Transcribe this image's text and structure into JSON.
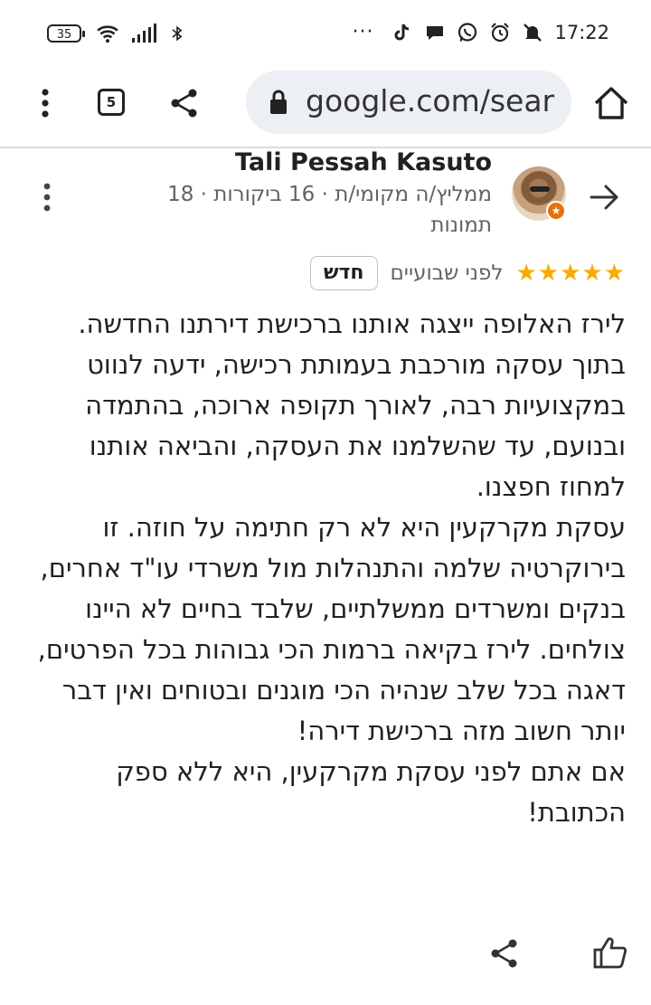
{
  "status_bar": {
    "battery": "35",
    "time": "17:22",
    "overflow": "···",
    "icons": [
      "wifi-icon",
      "signal-icon",
      "bluetooth-icon",
      "tiktok-icon",
      "chat-icon",
      "whatsapp-icon",
      "alarm-icon",
      "mute-icon"
    ]
  },
  "browser": {
    "tab_count": "5",
    "url": "google.com/sear",
    "icons": [
      "menu-dots-icon",
      "share-icon",
      "lock-icon",
      "home-icon"
    ]
  },
  "review": {
    "reviewer_name": "Tali Pessah Kasuto",
    "reviewer_meta": "ממליץ/ה מקומי/ת · 16 ביקורות · 18 תמונות",
    "rating": 5,
    "stars": "★★★★★",
    "when": "לפני שבועיים",
    "new_label": "חדש",
    "paragraphs": [
      "לירז האלופה ייצגה אותנו ברכישת דירתנו החדשה. בתוך עסקה מורכבת בעמותת רכישה, ידעה לנווט במקצועיות רבה, לאורך תקופה ארוכה, בהתמדה ובנועם, עד שהשלמנו את העסקה, והביאה אותנו למחוז חפצנו.",
      "עסקת מקרקעין היא לא רק חתימה על חוזה. זו בירוקרטיה שלמה והתנהלות מול משרדי עו\"ד אחרים, בנקים ומשרדים ממשלתיים, שלבד בחיים לא היינו צולחים. לירז בקיאה ברמות הכי גבוהות בכל הפרטים, דאגה בכל שלב שנהיה הכי מוגנים ובטוחים ואין דבר יותר חשוב מזה ברכישת דירה!",
      "אם אתם לפני עסקת מקרקעין, היא ללא ספק הכתובת!"
    ]
  },
  "colors": {
    "star": "#f9ab00",
    "url_bar_bg": "#eceff3",
    "secondary_text": "#5f6368",
    "badge": "#e8710a"
  }
}
